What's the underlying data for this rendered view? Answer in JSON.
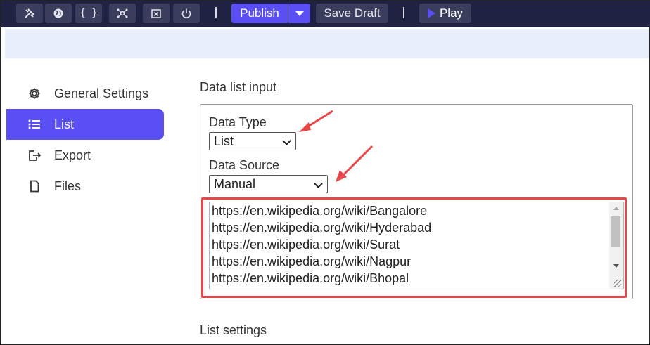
{
  "toolbar": {
    "icons": [
      "tools-icon",
      "globe-icon",
      "braces-icon",
      "network-icon",
      "close-box-icon",
      "power-icon"
    ],
    "publish_label": "Publish",
    "save_draft_label": "Save Draft",
    "play_label": "Play"
  },
  "sidebar": {
    "items": [
      {
        "label": "General Settings",
        "icon": "gear-icon",
        "active": false
      },
      {
        "label": "List",
        "icon": "list-icon",
        "active": true
      },
      {
        "label": "Export",
        "icon": "export-icon",
        "active": false
      },
      {
        "label": "Files",
        "icon": "file-icon",
        "active": false
      }
    ]
  },
  "main": {
    "section_title": "Data list input",
    "data_type_label": "Data Type",
    "data_type_value": "List",
    "data_source_label": "Data Source",
    "data_source_value": "Manual",
    "list_items": [
      "https://en.wikipedia.org/wiki/Bangalore",
      "https://en.wikipedia.org/wiki/Hyderabad",
      "https://en.wikipedia.org/wiki/Surat",
      "https://en.wikipedia.org/wiki/Nagpur",
      "https://en.wikipedia.org/wiki/Bhopal"
    ],
    "list_settings_title": "List settings"
  },
  "colors": {
    "toolbar_bg": "#1f2240",
    "accent": "#5a4ff5",
    "annotation_red": "#e8474a"
  }
}
